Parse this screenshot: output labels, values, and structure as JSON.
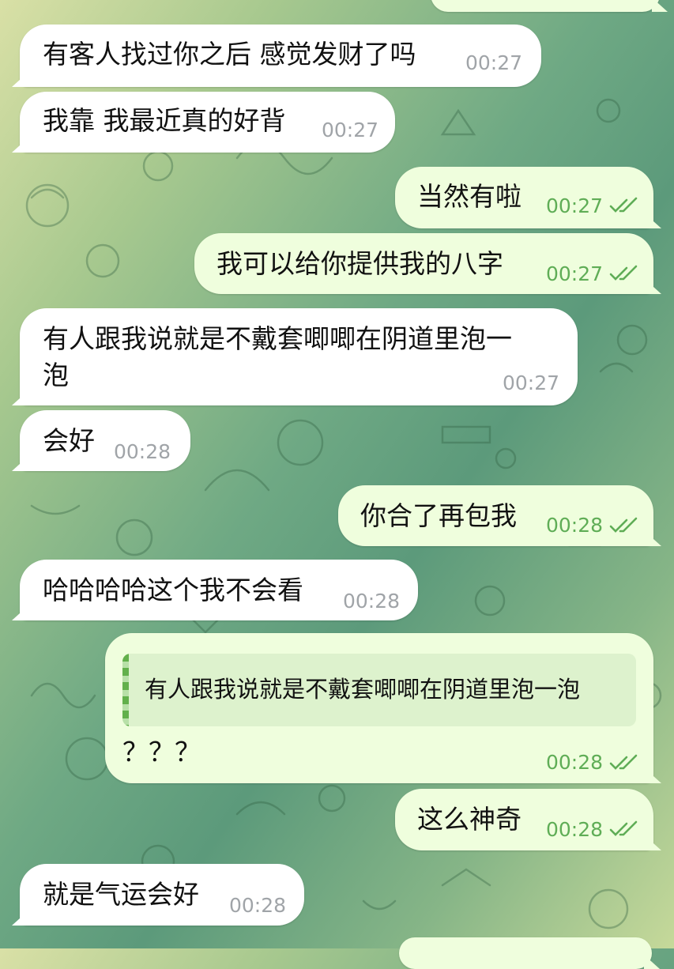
{
  "colors": {
    "incoming_bubble": "#ffffff",
    "outgoing_bubble": "#effedd",
    "outgoing_time": "#5fad56",
    "incoming_time": "#a0a4a8"
  },
  "messages": [
    {
      "dir": "in",
      "text": "有客人找过你之后 感觉发财了吗",
      "time": "00:27"
    },
    {
      "dir": "in",
      "text": "我靠 我最近真的好背",
      "time": "00:27"
    },
    {
      "dir": "out",
      "text": "当然有啦",
      "time": "00:27",
      "status": "read-double-check-icon"
    },
    {
      "dir": "out",
      "text": "我可以给你提供我的八字",
      "time": "00:27",
      "status": "read-double-check-icon"
    },
    {
      "dir": "in",
      "text_line1": "有人跟我说就是不戴套唧唧在阴道里泡一",
      "text_line2": "泡",
      "time": "00:27"
    },
    {
      "dir": "in",
      "text": "会好",
      "time": "00:28"
    },
    {
      "dir": "out",
      "text": "你合了再包我",
      "time": "00:28",
      "status": "read-double-check-icon"
    },
    {
      "dir": "in",
      "text": "哈哈哈哈这个我不会看",
      "time": "00:28"
    },
    {
      "dir": "out",
      "quote": "有人跟我说就是不戴套唧唧在阴道里泡一泡",
      "text": "？？？",
      "time": "00:28",
      "status": "read-double-check-icon"
    },
    {
      "dir": "out",
      "text": "这么神奇",
      "time": "00:28",
      "status": "read-double-check-icon"
    },
    {
      "dir": "in",
      "text": "就是气运会好",
      "time": "00:28"
    }
  ]
}
